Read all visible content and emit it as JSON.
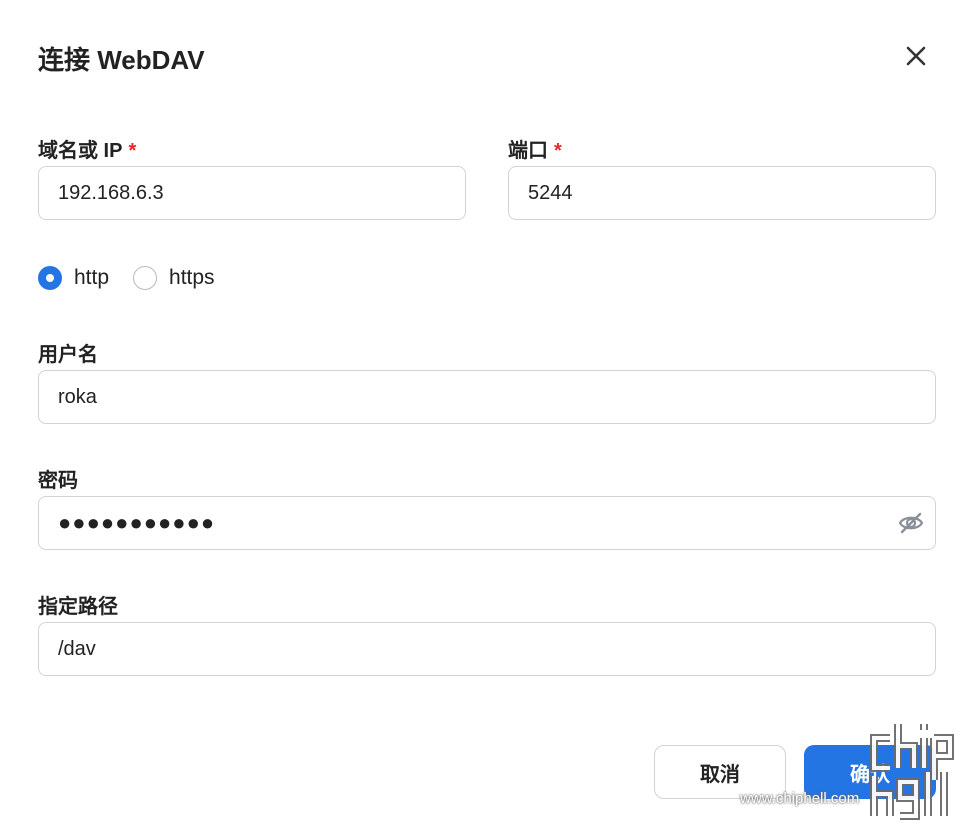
{
  "dialog": {
    "title": "连接 WebDAV"
  },
  "fields": {
    "host": {
      "label": "域名或 IP",
      "required_mark": "*",
      "value": "192.168.6.3"
    },
    "port": {
      "label": "端口",
      "required_mark": "*",
      "value": "5244"
    },
    "protocol": {
      "options": [
        {
          "label": "http",
          "checked": true
        },
        {
          "label": "https",
          "checked": false
        }
      ]
    },
    "username": {
      "label": "用户名",
      "value": "roka"
    },
    "password": {
      "label": "密码",
      "masked_value": "●●●●●●●●●●●",
      "toggle_icon": "eye-off-icon"
    },
    "path": {
      "label": "指定路径",
      "value": "/dav"
    }
  },
  "actions": {
    "cancel_label": "取消",
    "confirm_label": "确认"
  },
  "watermark": {
    "site": "www.chiphell.com"
  },
  "colors": {
    "accent": "#2475e4",
    "required": "#e5262b",
    "border": "#cfd3da",
    "text": "#222222"
  }
}
